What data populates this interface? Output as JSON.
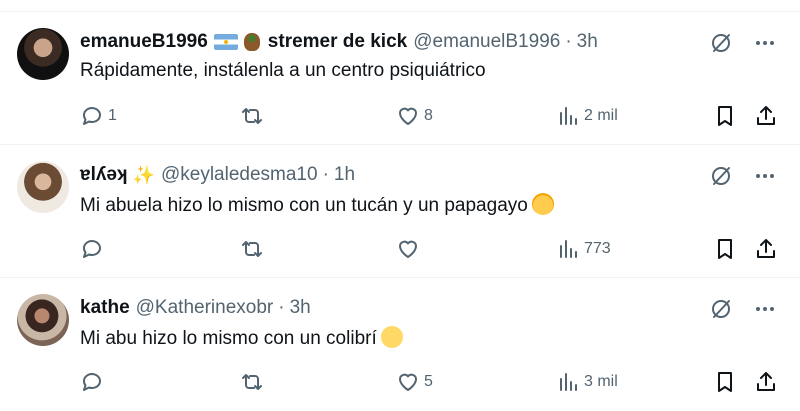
{
  "tweets": [
    {
      "name": "emanueB1996",
      "bio_tag": "stremer de kick",
      "handle": "@emanuelB1996",
      "time": "3h",
      "text": "Rápidamente, instálenla a un centro psiquiátrico",
      "replies": "1",
      "retweets": "",
      "likes": "8",
      "views": "2 mil"
    },
    {
      "name": "ɐlʎǝʞ",
      "handle": "@keylaledesma10",
      "time": "1h",
      "text": "Mi abuela hizo lo mismo con un tucán y un papagayo",
      "replies": "",
      "retweets": "",
      "likes": "",
      "views": "773"
    },
    {
      "name": "kathe",
      "handle": "@Katherinexobr",
      "time": "3h",
      "text": "Mi abu hizo lo mismo con un colibrí",
      "replies": "",
      "retweets": "",
      "likes": "5",
      "views": "3 mil"
    }
  ],
  "separator": "·",
  "theme": {
    "text": "#0f1419",
    "muted": "#536471",
    "divider": "#eff3f4"
  },
  "icons": [
    "grok-icon",
    "more-icon",
    "reply-icon",
    "retweet-icon",
    "like-icon",
    "views-icon",
    "bookmark-icon",
    "share-icon",
    "argentina-flag-icon",
    "mate-icon",
    "sparkles-icon",
    "rolling-laughing-emoji",
    "pleading-face-emoji"
  ]
}
